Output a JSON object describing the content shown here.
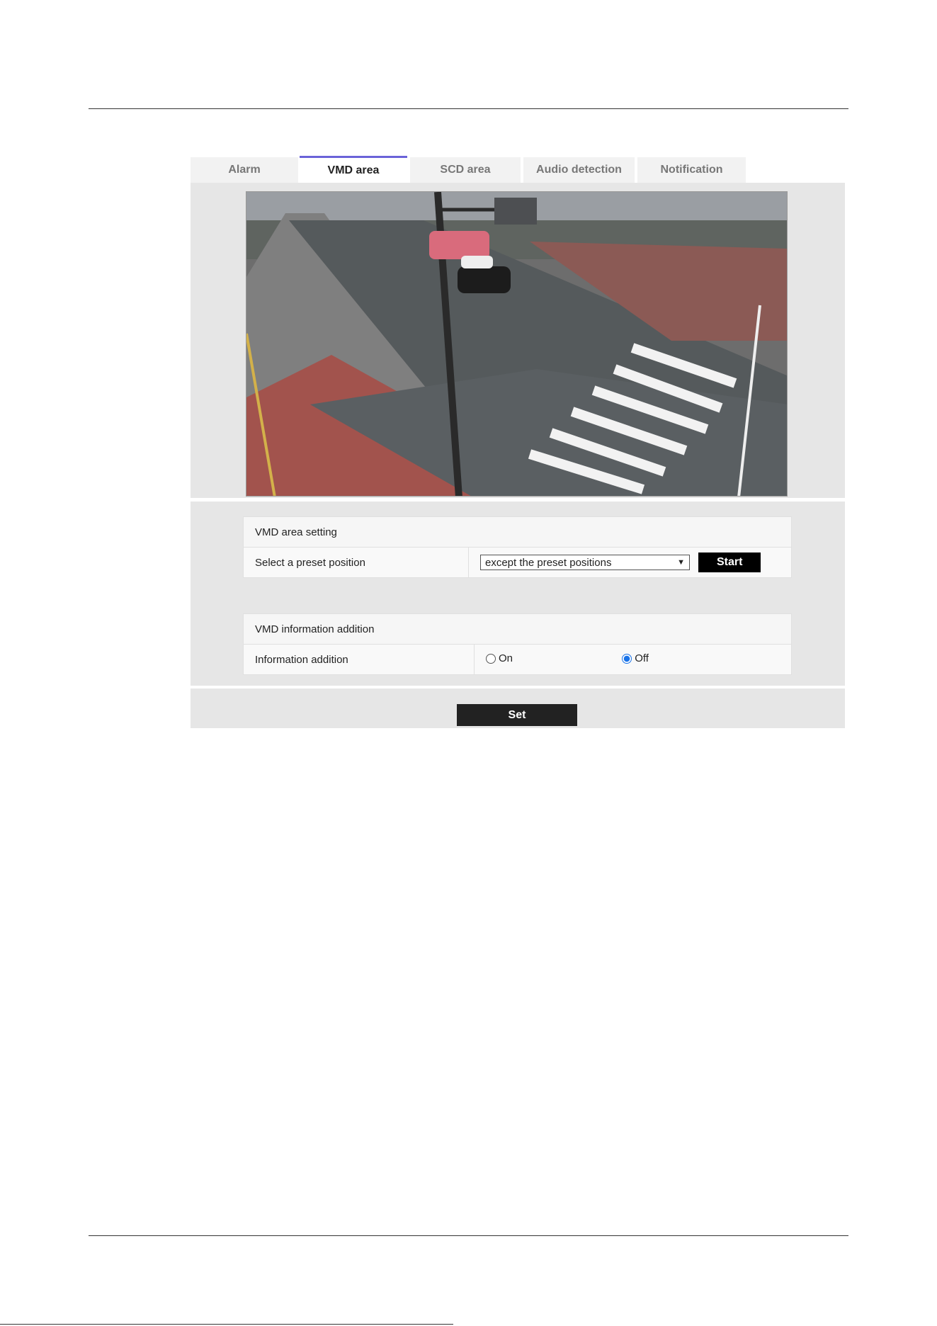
{
  "tabs": [
    "Alarm",
    "VMD area",
    "SCD area",
    "Audio detection",
    "Notification"
  ],
  "active_tab": "VMD area",
  "vmd_area": {
    "section_title": "VMD area setting",
    "preset_label": "Select a preset position",
    "preset_value": "except the preset positions",
    "start_label": "Start"
  },
  "vmd_info": {
    "section_title": "VMD information addition",
    "info_label": "Information addition",
    "on_label": "On",
    "off_label": "Off",
    "selected": "Off"
  },
  "set_label": "Set",
  "colors": {
    "tab_accent": "#6a63d8",
    "radio_selected": "#1a73e8"
  }
}
